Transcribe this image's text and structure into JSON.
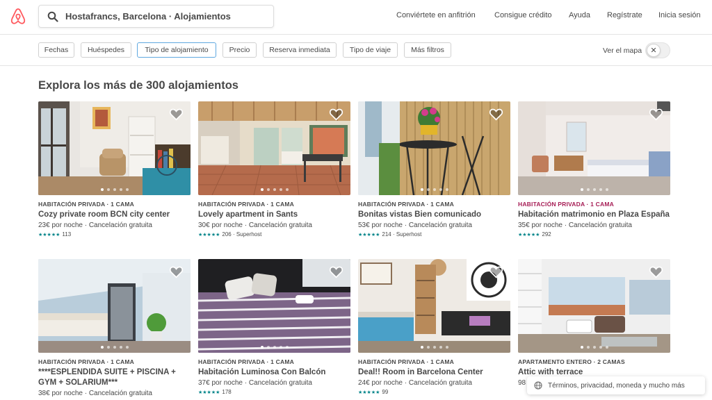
{
  "header": {
    "search_text": "Hostafrancs, Barcelona · Alojamientos",
    "nav": [
      "Conviértete en anfitrión",
      "Consigue crédito",
      "Ayuda",
      "Regístrate",
      "Inicia sesión"
    ]
  },
  "filters": {
    "chips": [
      "Fechas",
      "Huéspedes",
      "Tipo de alojamiento",
      "Precio",
      "Reserva inmediata",
      "Tipo de viaje",
      "Más filtros"
    ],
    "active_chip": "Tipo de alojamiento",
    "map_label": "Ver el mapa",
    "map_toggle_symbol": "✕"
  },
  "heading": "Explora los más de 300 alojamientos",
  "listings": [
    {
      "type": "HABITACIÓN PRIVADA · 1 CAMA",
      "title": "Cozy private room BCN city center",
      "price": "23€ por noche · Cancelación gratuita",
      "stars": "★★★★★",
      "rating": "113"
    },
    {
      "type": "HABITACIÓN PRIVADA · 1 CAMA",
      "title": "Lovely apartment in Sants",
      "price": "30€ por noche · Cancelación gratuita",
      "stars": "★★★★★",
      "rating": "206 · Superhost"
    },
    {
      "type": "HABITACIÓN PRIVADA · 1 CAMA",
      "title": "Bonitas vistas Bien comunicado",
      "price": "53€ por noche · Cancelación gratuita",
      "stars": "★★★★★",
      "rating": "214 · Superhost"
    },
    {
      "type": "HABITACIÓN PRIVADA · 1 CAMA",
      "title": "Habitación matrimonio en Plaza España",
      "price": "35€ por noche · Cancelación gratuita",
      "stars": "★★★★★",
      "rating": "292"
    },
    {
      "type": "HABITACIÓN PRIVADA · 1 CAMA",
      "title": "****ESPLENDIDA SUITE + PISCINA + GYM + SOLARIUM***",
      "price": "38€ por noche · Cancelación gratuita",
      "stars": "",
      "rating": ""
    },
    {
      "type": "HABITACIÓN PRIVADA · 1 CAMA",
      "title": "Habitación Luminosa Con Balcón",
      "price": "37€ por noche · Cancelación gratuita",
      "stars": "★★★★★",
      "rating": "178"
    },
    {
      "type": "HABITACIÓN PRIVADA · 1 CAMA",
      "title": "Deal!! Room in Barcelona Center",
      "price": "24€ por noche · Cancelación gratuita",
      "stars": "★★★★★",
      "rating": "99"
    },
    {
      "type": "APARTAMENTO ENTERO · 2 CAMAS",
      "title": "Attic with terrace",
      "price": "98",
      "stars": "",
      "rating": ""
    }
  ],
  "footer": {
    "label": "Términos, privacidad, moneda y mucho más"
  },
  "colors": {
    "brand": "#ff5a5f",
    "teal_stars": "#008489",
    "accent_type": "#a61d55",
    "active_chip_border": "#5fa8e0"
  },
  "icons": [
    "airbnb-logo",
    "search-icon",
    "heart-icon",
    "globe-icon",
    "close-icon"
  ]
}
